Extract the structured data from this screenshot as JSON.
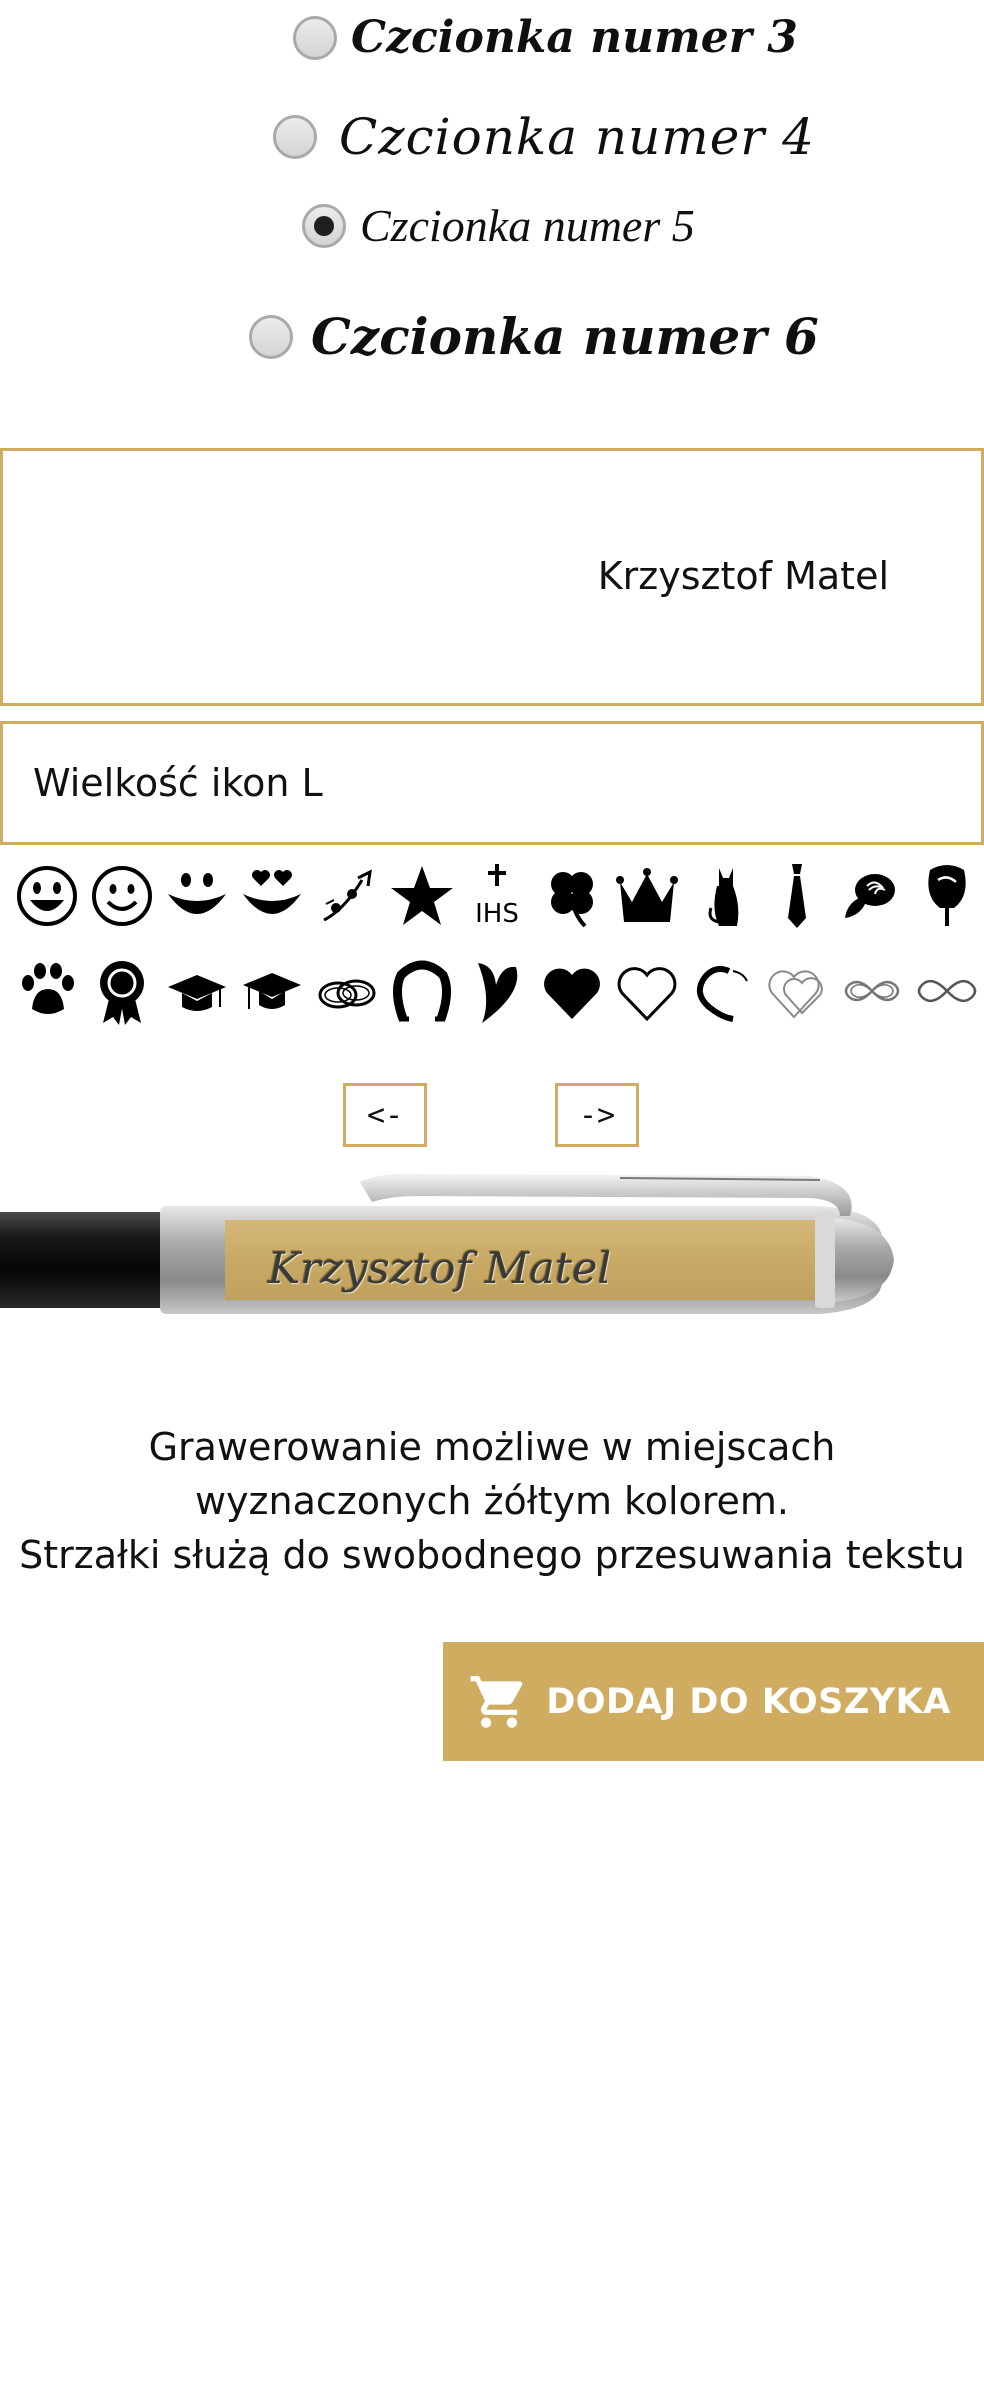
{
  "fonts": {
    "options": [
      {
        "label": "Czcionka numer 3",
        "selected": false
      },
      {
        "label": "Czcionka numer 4",
        "selected": false
      },
      {
        "label": "Czcionka numer 5",
        "selected": true
      },
      {
        "label": "Czcionka numer 6",
        "selected": false
      }
    ]
  },
  "engraving": {
    "text": "Krzysztof Matel"
  },
  "icon_size": {
    "label": "Wielkość ikon L"
  },
  "icons": {
    "row1": [
      "grin-face-icon",
      "smile-face-icon",
      "smile-tongue-icon",
      "hearts-eyes-smile-icon",
      "music-notes-icon",
      "star-icon",
      "ihs-cross-icon",
      "clover-icon",
      "crown-icon",
      "cat-icon",
      "tie-icon",
      "rose-icon",
      "rose-bud-icon"
    ],
    "row2": [
      "paw-icon",
      "award-rosette-icon",
      "graduation-cap-icon",
      "graduation-cap-2-icon",
      "wedding-rings-icon",
      "horseshoe-icon",
      "leaf-heart-icon",
      "heart-filled-icon",
      "heart-outline-icon",
      "heart-brush-icon",
      "heart-double-outline-icon",
      "infinity-double-icon",
      "infinity-icon"
    ]
  },
  "arrows": {
    "left": "<-",
    "right": "->"
  },
  "preview": {
    "engraving_text": "Krzysztof Matel"
  },
  "info": {
    "line1": "Grawerowanie możliwe w miejscach",
    "line2": "wyznaczonych żółtym kolorem.",
    "line3": "Strzałki służą do swobodnego przesuwania tekstu"
  },
  "cart": {
    "label": "DODAJ DO KOSZYKA",
    "icon": "cart-icon"
  },
  "colors": {
    "accent": "#cfac60",
    "radio_border": "#a9a9a9"
  }
}
